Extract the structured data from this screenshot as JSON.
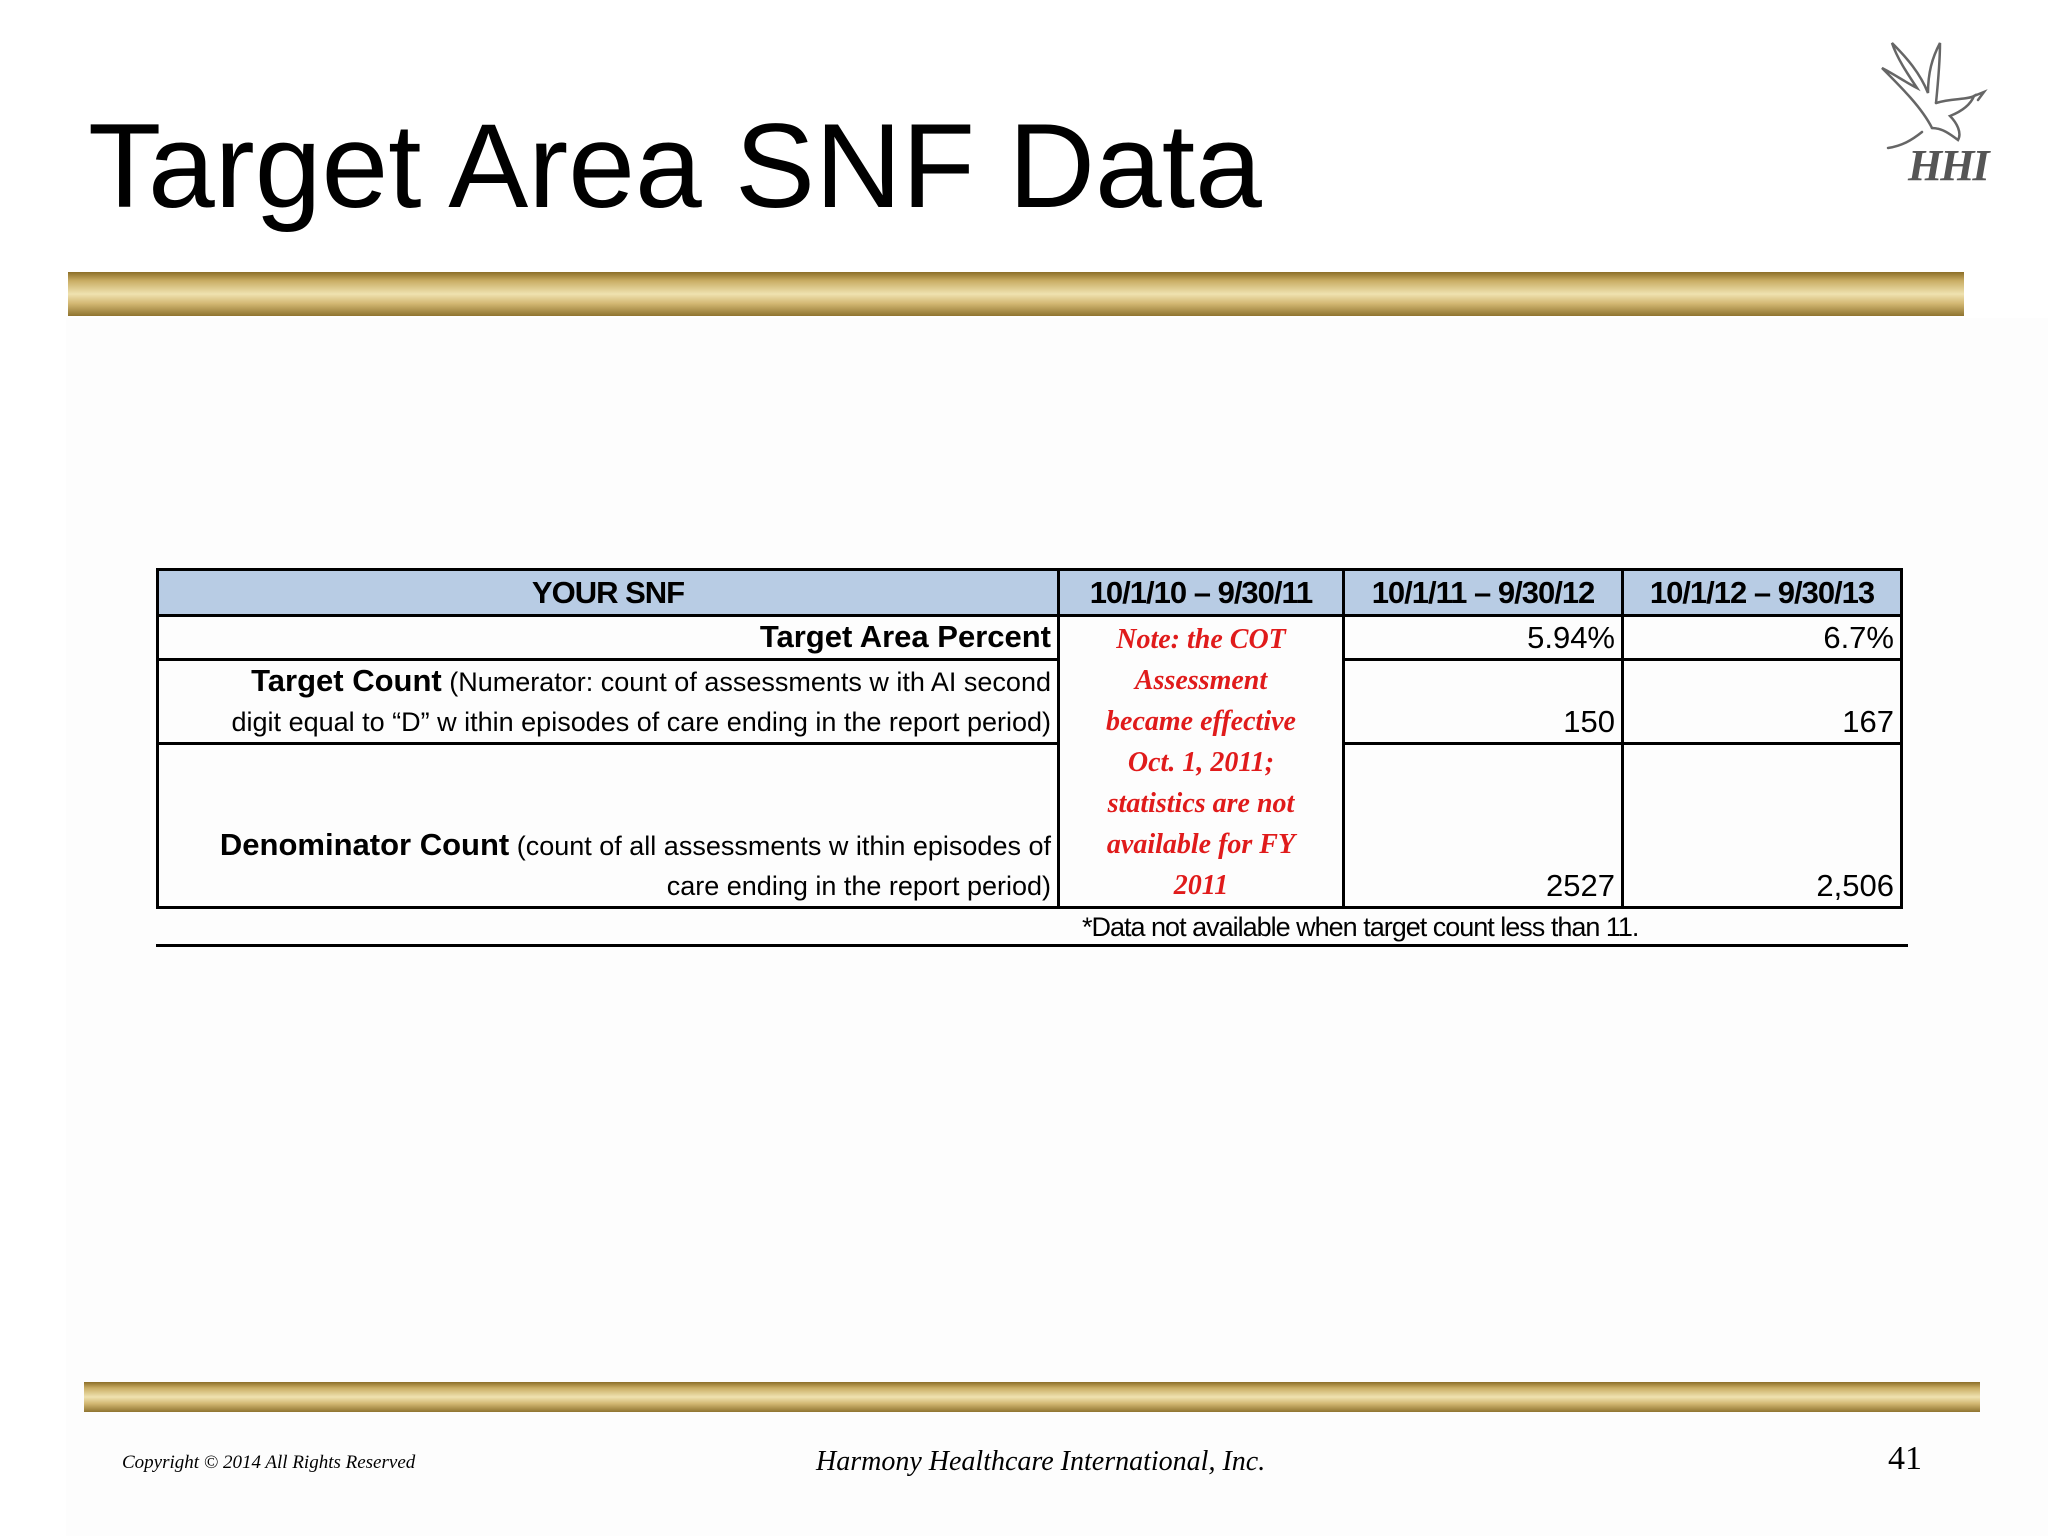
{
  "slide": {
    "title": "Target Area SNF Data",
    "logo_text": "HHI"
  },
  "table": {
    "headers": [
      "YOUR SNF",
      "10/1/10 – 9/30/11",
      "10/1/11 – 9/30/12",
      "10/1/12 – 9/30/13"
    ],
    "rows": {
      "target_area_percent": {
        "label": "Target Area Percent",
        "values": [
          "5.94%",
          "6.7%"
        ]
      },
      "target_count": {
        "label_bold": "Target Count",
        "label_rest_1": " (Numerator: count of assessments w ith AI second",
        "label_rest_2": "digit equal to “D” w ithin episodes of care ending in the report period)",
        "values": [
          "150",
          "167"
        ]
      },
      "denominator_count": {
        "label_bold": "Denominator Count",
        "label_rest_1": " (count of all assessments w ithin episodes of",
        "label_rest_2": "care ending in the report period)",
        "values": [
          "2527",
          "2,506"
        ]
      }
    },
    "note_lines": [
      "Note: the COT",
      "Assessment",
      "became effective",
      "Oct. 1, 2011;",
      "statistics are not",
      "available for FY",
      "2011"
    ],
    "footnote": "*Data not available when target count less than 11."
  },
  "footer": {
    "copyright": "Copyright © 2014 All Rights Reserved",
    "company": "Harmony Healthcare International, Inc.",
    "page_number": "41"
  },
  "colors": {
    "header_fill": "#b8cce4",
    "note_red": "#e01b1b",
    "gold_bar": "#c9ad64"
  }
}
